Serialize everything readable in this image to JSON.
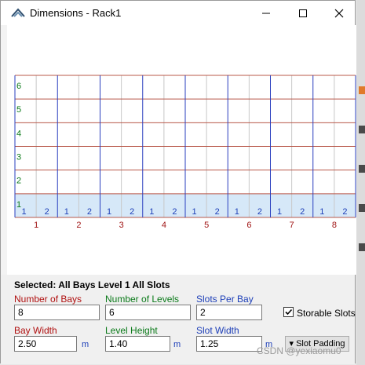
{
  "window": {
    "title": "Dimensions - Rack1",
    "controls": {
      "minimize": "minimize-icon",
      "maximize": "maximize-icon",
      "close": "close-icon"
    }
  },
  "grid": {
    "levels": [
      "1",
      "2",
      "3",
      "4",
      "5",
      "6"
    ],
    "bays": [
      "1",
      "2",
      "3",
      "4",
      "5",
      "6",
      "7",
      "8"
    ],
    "slots_per_bay": [
      "1",
      "2"
    ],
    "selected_level": "1",
    "colors": {
      "bay_line": "#2a3fbf",
      "level_line": "#b8584a",
      "slot_line": "#c8c8c8",
      "selection_fill": "#d6e8f8",
      "bay_label": "#a01515",
      "level_label": "#0b7a1a",
      "slot_label": "#1d3fb8"
    }
  },
  "selection": {
    "text": "Selected: All Bays Level 1 All Slots"
  },
  "fields": {
    "number_of_bays": {
      "label": "Number of Bays",
      "value": "8"
    },
    "number_of_levels": {
      "label": "Number of Levels",
      "value": "6"
    },
    "slots_per_bay": {
      "label": "Slots Per Bay",
      "value": "2"
    },
    "bay_width": {
      "label": "Bay Width",
      "value": "2.50",
      "unit": "m"
    },
    "level_height": {
      "label": "Level Height",
      "value": "1.40",
      "unit": "m"
    },
    "slot_width": {
      "label": "Slot Width",
      "value": "1.25",
      "unit": "m"
    }
  },
  "storable_slots": {
    "label": "Storable Slots",
    "checked": true
  },
  "slot_padding_button": {
    "label": "▾ Slot Padding"
  },
  "watermark": "CSDN @yexiaomu0"
}
